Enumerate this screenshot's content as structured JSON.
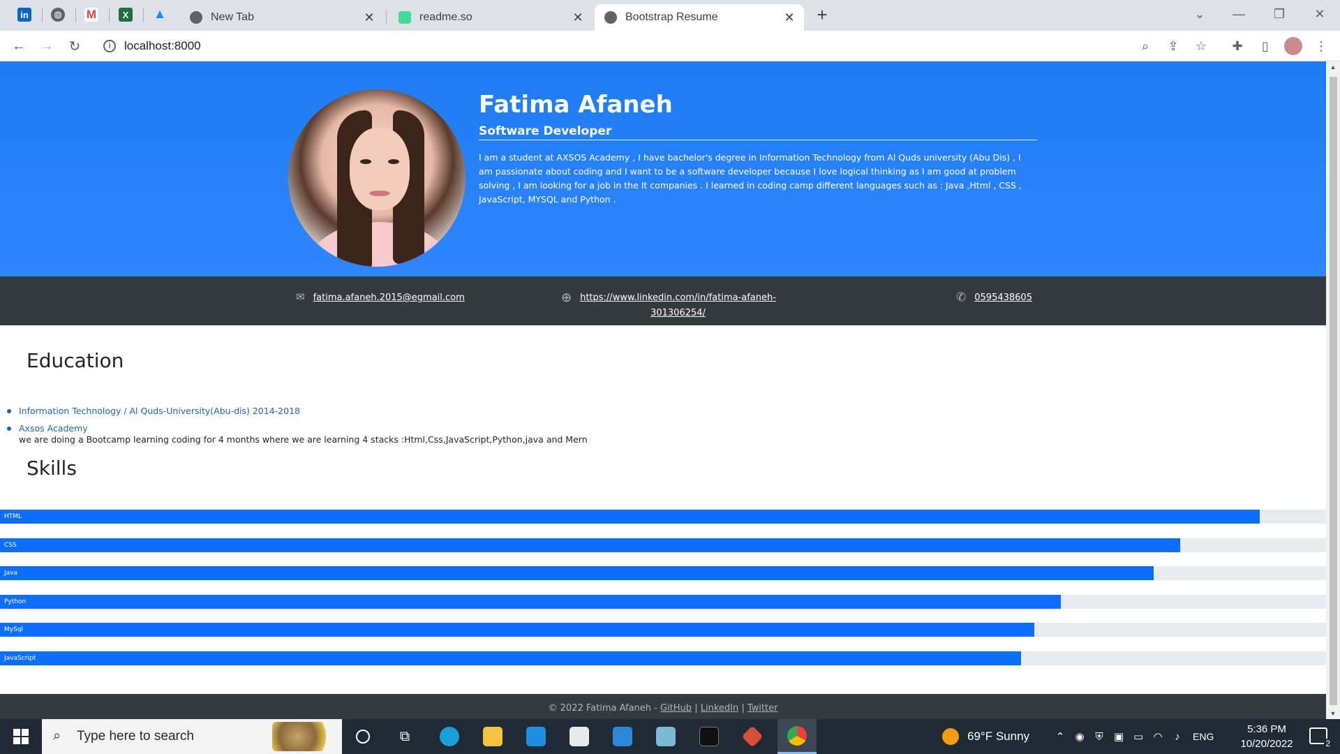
{
  "browser": {
    "tabs": [
      {
        "title": "New Tab",
        "active": false
      },
      {
        "title": "readme.so",
        "active": false
      },
      {
        "title": "Bootstrap Resume",
        "active": true
      }
    ],
    "pinned_tabs": [
      "linkedin-icon",
      "globe-icon",
      "gmail-icon",
      "excel-icon",
      "atlassian-icon"
    ],
    "url": "localhost:8000"
  },
  "hero": {
    "name": "Fatima Afaneh",
    "title": "Software Developer",
    "bio": "I am a student at AXSOS Academy , I have bachelor's degree in Information Technology from Al Quds university (Abu Dis) , I am passionate about coding and I want to be a software developer because I love logical thinking as I am good at problem solving , I am looking for a job in the It companies . I learned in coding camp different languages such as : Java ,Html , CSS , JavaScript, MYSQL and Python ."
  },
  "contact": {
    "email": "fatima.afaneh.2015@egmail.com",
    "linkedin_line1": "https://www.linkedin.com/in/fatima-afaneh-",
    "linkedin_line2": "301306254/",
    "phone": "0595438605"
  },
  "education": {
    "heading": "Education",
    "items": [
      "Information Technology / Al Quds-University(Abu-dis) 2014-2018",
      "Axsos Academy"
    ],
    "note": "we are doing a Bootcamp learning coding for 4 months where we are learning 4 stacks :Html,Css,JavaScript,Python,java and Mern"
  },
  "skills": {
    "heading": "Skills",
    "items": [
      {
        "name": "HTML",
        "percent": 95
      },
      {
        "name": "CSS",
        "percent": 89
      },
      {
        "name": "Java",
        "percent": 87
      },
      {
        "name": "Python",
        "percent": 80
      },
      {
        "name": "MySql",
        "percent": 78
      },
      {
        "name": "JavaScript",
        "percent": 77
      }
    ]
  },
  "footer": {
    "copyright": "© 2022 Fatima Afaneh -",
    "link_github": "GitHub",
    "link_linkedin": "LinkedIn",
    "link_twitter": "Twitter",
    "sep": "|"
  },
  "taskbar": {
    "search_placeholder": "Type here to search",
    "weather": "69°F  Sunny",
    "language": "ENG",
    "time": "5:36 PM",
    "date": "10/20/2022",
    "notification_count": "2"
  },
  "colors": {
    "hero_blue": "#2f85ff",
    "contact_bar": "#343a40",
    "progress_fill": "#0d6efd",
    "progress_track": "#e9ecef",
    "link_blue": "#1f64b9"
  }
}
